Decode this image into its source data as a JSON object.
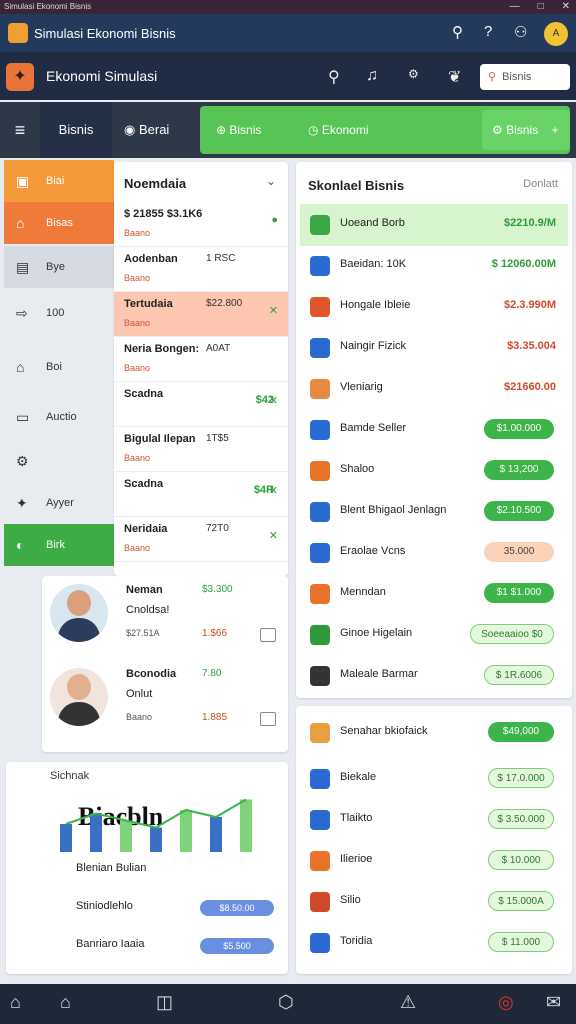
{
  "system": {
    "title": "Simulasi Ekonomi Bisnis",
    "controls": [
      "—",
      "□",
      "✕"
    ]
  },
  "topbar": {
    "title": "Simulasi Ekonomi Bisnis",
    "avatar": "A"
  },
  "appbar": {
    "title": "Ekonomi Simulasi",
    "search_placeholder": "Bisnis",
    "bag_label": "Bisnis"
  },
  "tabs": {
    "menu": "≡",
    "t1": "Bisnis",
    "t2": "Berai",
    "g1": "Bisnis",
    "g2": "Ekonomi",
    "g3": "Bisnis",
    "plus": "+"
  },
  "sidenav": [
    {
      "label": "Biai",
      "color": "#f59a3a",
      "icon": "▣",
      "text_color": "#fff"
    },
    {
      "label": "Bisas",
      "color": "#f07a3a",
      "icon": "⌂",
      "text_color": "#fff"
    },
    {
      "label": "Bye",
      "color": "#d6dbe3",
      "icon": "▤",
      "text_color": "#333"
    },
    {
      "label": "100",
      "color": "#e8ebef",
      "icon": "⇨",
      "text_color": "#333"
    },
    {
      "label": "Boi",
      "color": "#e8ebef",
      "icon": "⌂",
      "text_color": "#333"
    },
    {
      "label": "Auctio",
      "color": "#e8ebef",
      "icon": "▭",
      "text_color": "#333"
    },
    {
      "label": "",
      "color": "#e8ebef",
      "icon": "⚙",
      "text_color": "#333"
    },
    {
      "label": "Ayyer",
      "color": "#e8ebef",
      "icon": "✦",
      "text_color": "#333"
    },
    {
      "label": "Birk",
      "color": "#3eac46",
      "icon": "◐",
      "text_color": "#fff"
    }
  ],
  "middle": {
    "header": "Noemdaia",
    "rows": [
      {
        "title": "$ 21855 $3.1K6",
        "value": "",
        "sub": "Baano",
        "right": "●",
        "bg": "#fff"
      },
      {
        "title": "Aodenban",
        "value": "1 RSC",
        "sub": "Baano",
        "right": "",
        "bg": "#fff"
      },
      {
        "title": "Tertudaia",
        "value": "$22.800",
        "sub": "Baano",
        "right": "✕",
        "bg": "#fcc6b0"
      },
      {
        "title": "Neria Bongen:",
        "value": "A0AT",
        "sub": "Baano",
        "right": "",
        "bg": "#fff"
      },
      {
        "title": "Scadna",
        "value": "$42",
        "sub": "",
        "right": "✕",
        "bg": "#fff"
      },
      {
        "title": "Bigulal Ilepan",
        "value": "1T$5",
        "sub": "Baano",
        "right": "",
        "bg": "#fff"
      },
      {
        "title": "Scadna",
        "value": "$4R",
        "sub": "",
        "right": "✕",
        "bg": "#fff"
      },
      {
        "title": "Neridaia",
        "value": "72T0",
        "sub": "Baano",
        "right": "✕",
        "bg": "#fff"
      }
    ]
  },
  "persons": [
    {
      "name": "Neman",
      "name2": "Cnoldsa!",
      "amount": "$3.300",
      "small": "$27.51A",
      "price": "1.$66"
    },
    {
      "name": "Bconodia",
      "name2": "Onlut",
      "amount": "7.80",
      "small": "Baano",
      "price": "1.885"
    }
  ],
  "chartpanel": {
    "header": "Sichnak",
    "big": "Biacbln",
    "rows": [
      {
        "label": "Blenian Bulian",
        "badge": ""
      },
      {
        "label": "Stiniodlehlo",
        "badge": "$8.50.00"
      },
      {
        "label": "Banriaro Iaaia",
        "badge": "$5.500"
      }
    ]
  },
  "chart_data": {
    "type": "bar",
    "categories": [
      "1",
      "2",
      "3",
      "4",
      "5",
      "6",
      "7"
    ],
    "values": [
      40,
      55,
      45,
      35,
      60,
      50,
      75
    ],
    "title": "",
    "xlabel": "",
    "ylabel": "",
    "ylim": [
      0,
      100
    ]
  },
  "rightpanel": {
    "header": "Skonlael Bisnis",
    "header2": "Donlatt",
    "rows": [
      {
        "label": "Uoeand Borb",
        "value": "$2210.9/M",
        "color": "#2f9a3a",
        "highlight": true,
        "icon_color": "#3aa844"
      },
      {
        "label": "Baeidan: 10K",
        "value": "$ 12060.00M",
        "color": "#2f9a3a",
        "highlight": false,
        "icon_color": "#2b6ad0"
      },
      {
        "label": "Hongale Ibleie",
        "value": "$2.3.990M",
        "color": "#d04a2a",
        "highlight": false,
        "icon_color": "#e0552a"
      },
      {
        "label": "Naingir Fizick",
        "value": "$3.35.004",
        "color": "#d04a2a",
        "highlight": false,
        "icon_color": "#2b6ad0"
      },
      {
        "label": "Vleniarig",
        "value": "$21660.00",
        "color": "#d04a2a",
        "highlight": false,
        "icon_color": "#e88a40"
      },
      {
        "label": "Bamde Seller",
        "value": "$1.00.000",
        "color": "#fff",
        "highlight": false,
        "icon_color": "#2b6ad0",
        "pill": "green"
      },
      {
        "label": "Shaloo",
        "value": "$ 13,200",
        "color": "#fff",
        "highlight": false,
        "icon_color": "#e8742a",
        "pill": "green"
      },
      {
        "label": "Blent Bhigaol Jenlagn",
        "value": "$2.10.500",
        "color": "#fff",
        "highlight": false,
        "icon_color": "#2b6ad0",
        "pill": "green"
      },
      {
        "label": "Eraolae Vcns",
        "value": "35.000",
        "color": "#444",
        "highlight": false,
        "icon_color": "#2b6ad0",
        "pill": "peach"
      },
      {
        "label": "Menndan",
        "value": "$1 $1.000",
        "color": "#fff",
        "highlight": false,
        "icon_color": "#e8742a",
        "pill": "green"
      },
      {
        "label": "Ginoe Higelain",
        "value": "Soeeaaioo $0",
        "color": "#2f7a2a",
        "highlight": false,
        "icon_color": "#2f9a3a",
        "pill": "light"
      },
      {
        "label": "Maleale Barmar",
        "value": "$ 1R.6006",
        "color": "#2f7a2a",
        "highlight": false,
        "icon_color": "#333",
        "pill": "light2"
      }
    ]
  },
  "bottompanel": {
    "header": "Senahar bkiofaick",
    "headbadge": "$49,000",
    "rows": [
      {
        "label": "Biekale",
        "value": "$ 17.0.000"
      },
      {
        "label": "Tlaikto",
        "value": "$ 3.50.000"
      },
      {
        "label": "Ilierioe",
        "value": "$ 10.000"
      },
      {
        "label": "Silio",
        "value": "$ 15.000A"
      },
      {
        "label": "Toridia",
        "value": "$ 11.000"
      }
    ]
  },
  "bottomnav": [
    "⌂",
    "⌂",
    "◫",
    "⬡",
    "⚠",
    "◎",
    "✉"
  ]
}
